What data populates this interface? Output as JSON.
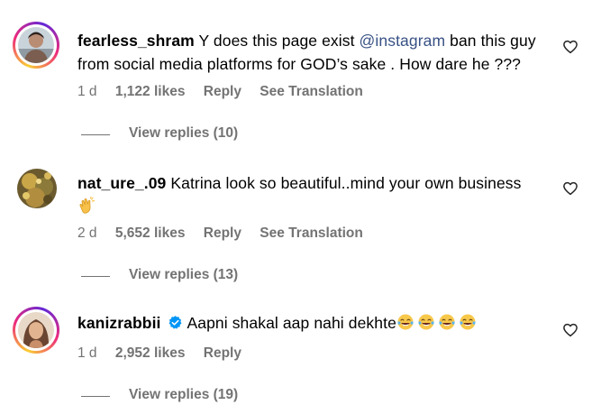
{
  "comments": [
    {
      "username": "fearless_shram",
      "text_before": "Y does this page exist ",
      "mention": "@instagram",
      "text_after": " ban this guy",
      "text_line2": "from social media platforms for GOD’s sake . How dare he ???",
      "time": "1 d",
      "likes": "1,122 likes",
      "reply": "Reply",
      "translate": "See Translation",
      "view_replies": "View replies (10)"
    },
    {
      "username": "nat_ure_.09",
      "text": "Katrina look so beautiful..mind your own business",
      "time": "2 d",
      "likes": "5,652 likes",
      "reply": "Reply",
      "translate": "See Translation",
      "view_replies": "View replies (13)"
    },
    {
      "username": "kanizrabbii",
      "text": "Aapni shakal aap nahi dekhte",
      "time": "1 d",
      "likes": "2,952 likes",
      "reply": "Reply",
      "view_replies": "View replies (19)"
    }
  ],
  "icons": {
    "like": "heart-outline-icon",
    "verified": "verified-badge-icon",
    "clap": "clapping-hands-emoji",
    "laugh": "tears-of-joy-emoji"
  },
  "colors": {
    "text": "#000000",
    "secondary": "#737373",
    "mention": "#385185",
    "verified": "#0095f6"
  }
}
